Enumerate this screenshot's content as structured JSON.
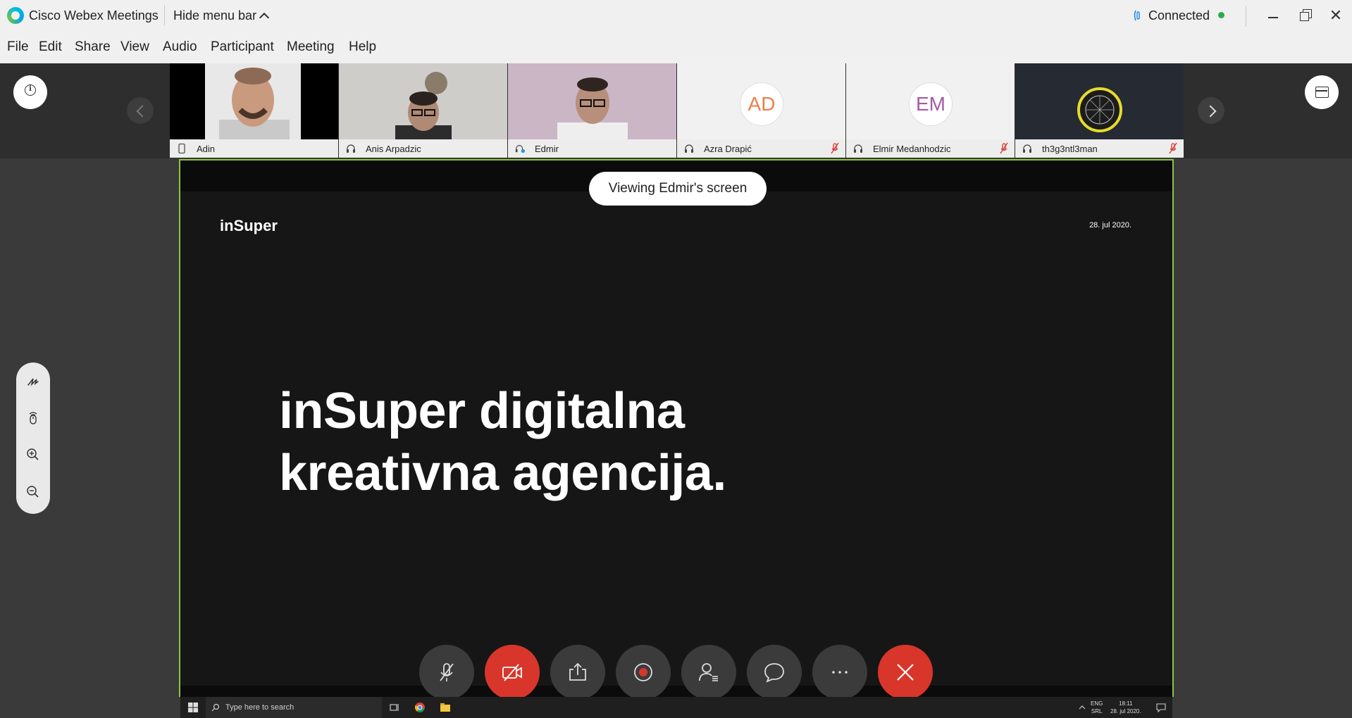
{
  "titlebar": {
    "app_title": "Cisco Webex Meetings",
    "hide_menu": "Hide menu bar",
    "connection_status": "Connected"
  },
  "menu": [
    "File",
    "Edit",
    "Share",
    "View",
    "Audio",
    "Participant",
    "Meeting",
    "Help"
  ],
  "participants": [
    {
      "name": "Adin",
      "type": "video"
    },
    {
      "name": "Anis Arpadzic",
      "type": "video"
    },
    {
      "name": "Edmir",
      "type": "video"
    },
    {
      "name": "Azra Drapić",
      "type": "avatar",
      "initials": "AD",
      "muted": true
    },
    {
      "name": "Elmir Medanhodzic",
      "type": "avatar",
      "initials": "EM",
      "muted": true
    },
    {
      "name": "th3g3ntl3man",
      "type": "image",
      "muted": true
    }
  ],
  "share": {
    "viewing_label": "Viewing Edmir's screen",
    "slide_brand": "inSuper",
    "slide_date": "28. jul 2020.",
    "headline_line1": "inSuper digitalna",
    "headline_line2": "kreativna agencija."
  },
  "controls": [
    "mute",
    "stop-video",
    "share",
    "record",
    "participants",
    "chat",
    "more",
    "end-meeting"
  ],
  "taskbar": {
    "search_placeholder": "Type here to search",
    "lang_top": "ENG",
    "lang_bottom": "SRL",
    "time": "18:11",
    "date": "28. jul 2020."
  },
  "colors": {
    "accent_red": "#d9362b",
    "share_border": "#8cc63f",
    "connected_dot": "#2eaa47",
    "initials_ad": "#e8804b",
    "initials_em": "#a65aa6"
  }
}
